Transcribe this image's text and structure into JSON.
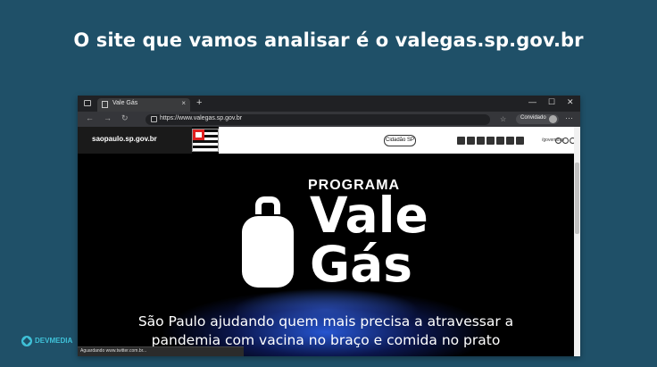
{
  "slide": {
    "title": "O site que vamos analisar é o valegas.sp.gov.br",
    "logo_text": "DEVMEDIA"
  },
  "browser": {
    "tab_title": "Vale Gás",
    "tab_close": "×",
    "new_tab": "+",
    "window_controls": [
      "—",
      "☐",
      "✕"
    ],
    "nav_icons": [
      "←",
      "→",
      "↻"
    ],
    "url": "https://www.valegas.sp.gov.br",
    "guest_label": "Convidado",
    "menu": "···",
    "status_text": "Aguardando www.twitter.com.br..."
  },
  "site": {
    "domain": "saopaulo.sp.gov.br",
    "cidadao_button": "Cidadão SP",
    "social_icons": [
      "facebook-icon",
      "twitter-icon",
      "instagram-icon",
      "flickr-icon",
      "youtube-icon",
      "instagram-icon",
      "linkedin-icon"
    ],
    "social_labels": [
      "f",
      "t",
      "◎",
      "fl",
      "▶",
      "◎",
      "in"
    ],
    "gov_handle": "/governosp",
    "accessibility_labels": [
      "⊕",
      "⊖",
      "◐"
    ]
  },
  "hero": {
    "programa": "PROGRAMA",
    "vale": "Vale",
    "gas": "Gás",
    "tagline_line1": "São Paulo ajudando quem mais precisa a atravessar a",
    "tagline_line2": "pandemia com vacina no braço e comida no prato"
  },
  "colors": {
    "slide_background": "#1f5068",
    "logo_accent": "#3fc1d8",
    "flame_blue": "#285adc"
  }
}
